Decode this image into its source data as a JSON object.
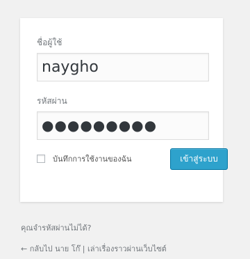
{
  "login_form": {
    "username_label": "ชื่อผู้ใช้",
    "username_value": "naygho",
    "password_label": "รหัสผ่าน",
    "password_value": "●●●●●●●●●",
    "remember_label": "บันทึกการใช้งานของฉัน",
    "remember_checked": false,
    "submit_label": "เข้าสู่ระบบ"
  },
  "links": {
    "lost_password": "คุณจำรหัสผ่านไม่ได้?",
    "back_to_site": "← กลับไป นาย โก๊ | เล่าเรื่องราวผ่านเว็บไซต์"
  },
  "colors": {
    "background": "#f1f1f1",
    "card": "#ffffff",
    "button": "#2ea2cc",
    "link": "#72777c"
  }
}
